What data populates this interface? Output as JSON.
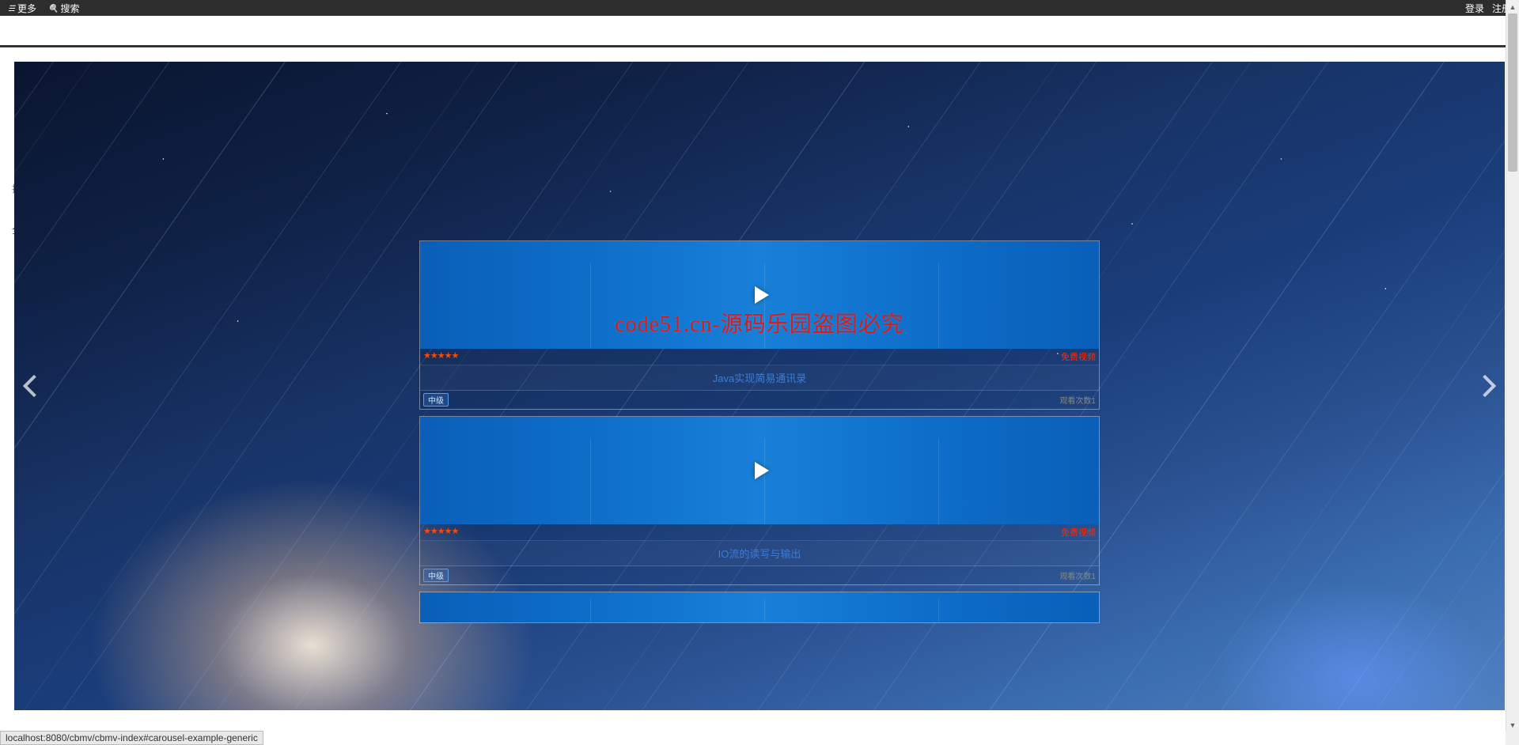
{
  "topbar": {
    "more": "更多",
    "search": "搜索",
    "login": "登录",
    "register": "注册"
  },
  "sideHints": {
    "h1": "推",
    "h2": "全"
  },
  "watermark": "code51.cn-源码乐园盗图必究",
  "cards": [
    {
      "stars": "★★★★★",
      "free": "免费视频",
      "title": "Java实现简易通讯录",
      "level": "中级",
      "views": "观看次数1"
    },
    {
      "stars": "★★★★★",
      "free": "免费视频",
      "title": "IO流的读写与输出",
      "level": "中级",
      "views": "观看次数1"
    }
  ],
  "statusbar": "localhost:8080/cbmv/cbmv-index#carousel-example-generic"
}
